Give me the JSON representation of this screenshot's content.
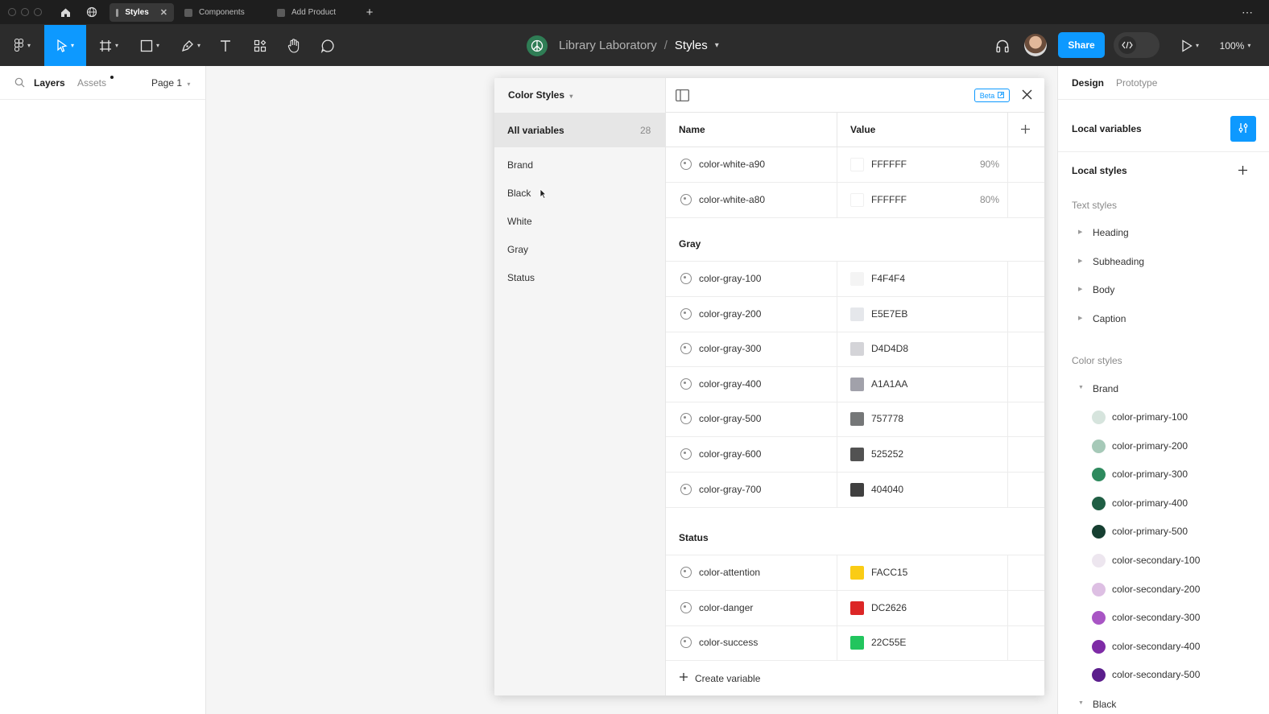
{
  "tabs": [
    {
      "label": "Styles",
      "active": true
    },
    {
      "label": "Components",
      "active": false
    },
    {
      "label": "Add Product",
      "active": false
    }
  ],
  "toolbar": {
    "project": "Library Laboratory",
    "separator": "/",
    "file": "Styles",
    "share_label": "Share",
    "zoom": "100%"
  },
  "left_panel": {
    "layers_label": "Layers",
    "assets_label": "Assets",
    "page_label": "Page 1"
  },
  "modal": {
    "title": "Color Styles",
    "beta_label": "Beta",
    "all_variables_label": "All variables",
    "all_variables_count": "28",
    "categories": [
      "Brand",
      "Black",
      "White",
      "Gray",
      "Status"
    ],
    "col_name": "Name",
    "col_value": "Value",
    "white_rows": [
      {
        "name": "color-white-a90",
        "hex": "FFFFFF",
        "pct": "90%",
        "color": "#ffffff"
      },
      {
        "name": "color-white-a80",
        "hex": "FFFFFF",
        "pct": "80%",
        "color": "#ffffff"
      }
    ],
    "gray_section": "Gray",
    "gray_rows": [
      {
        "name": "color-gray-100",
        "hex": "F4F4F4",
        "color": "#F4F4F4"
      },
      {
        "name": "color-gray-200",
        "hex": "E5E7EB",
        "color": "#E5E7EB"
      },
      {
        "name": "color-gray-300",
        "hex": "D4D4D8",
        "color": "#D4D4D8"
      },
      {
        "name": "color-gray-400",
        "hex": "A1A1AA",
        "color": "#A1A1AA"
      },
      {
        "name": "color-gray-500",
        "hex": "757778",
        "color": "#757778"
      },
      {
        "name": "color-gray-600",
        "hex": "525252",
        "color": "#525252"
      },
      {
        "name": "color-gray-700",
        "hex": "404040",
        "color": "#404040"
      }
    ],
    "status_section": "Status",
    "status_rows": [
      {
        "name": "color-attention",
        "hex": "FACC15",
        "color": "#FACC15"
      },
      {
        "name": "color-danger",
        "hex": "DC2626",
        "color": "#DC2626"
      },
      {
        "name": "color-success",
        "hex": "22C55E",
        "color": "#22C55E"
      }
    ],
    "create_label": "Create variable"
  },
  "right_panel": {
    "design_tab": "Design",
    "prototype_tab": "Prototype",
    "local_variables": "Local variables",
    "local_styles": "Local styles",
    "text_styles": "Text styles",
    "text_style_items": [
      "Heading",
      "Subheading",
      "Body",
      "Caption"
    ],
    "color_styles": "Color styles",
    "brand_group": "Brand",
    "color_style_items": [
      {
        "name": "color-primary-100",
        "color": "#D6E4DD"
      },
      {
        "name": "color-primary-200",
        "color": "#A6C9B8"
      },
      {
        "name": "color-primary-300",
        "color": "#2E8A5E"
      },
      {
        "name": "color-primary-400",
        "color": "#1F5E44"
      },
      {
        "name": "color-primary-500",
        "color": "#163F31"
      },
      {
        "name": "color-secondary-100",
        "color": "#EDE6EF"
      },
      {
        "name": "color-secondary-200",
        "color": "#DDBFE3"
      },
      {
        "name": "color-secondary-300",
        "color": "#A855C4"
      },
      {
        "name": "color-secondary-400",
        "color": "#7E2BA6"
      },
      {
        "name": "color-secondary-500",
        "color": "#5B1E8C"
      }
    ],
    "black_group": "Black"
  },
  "colors": {
    "accent": "#0d99ff",
    "toolbar_bg": "#2c2c2c",
    "tabbar_bg": "#1e1e1e"
  }
}
